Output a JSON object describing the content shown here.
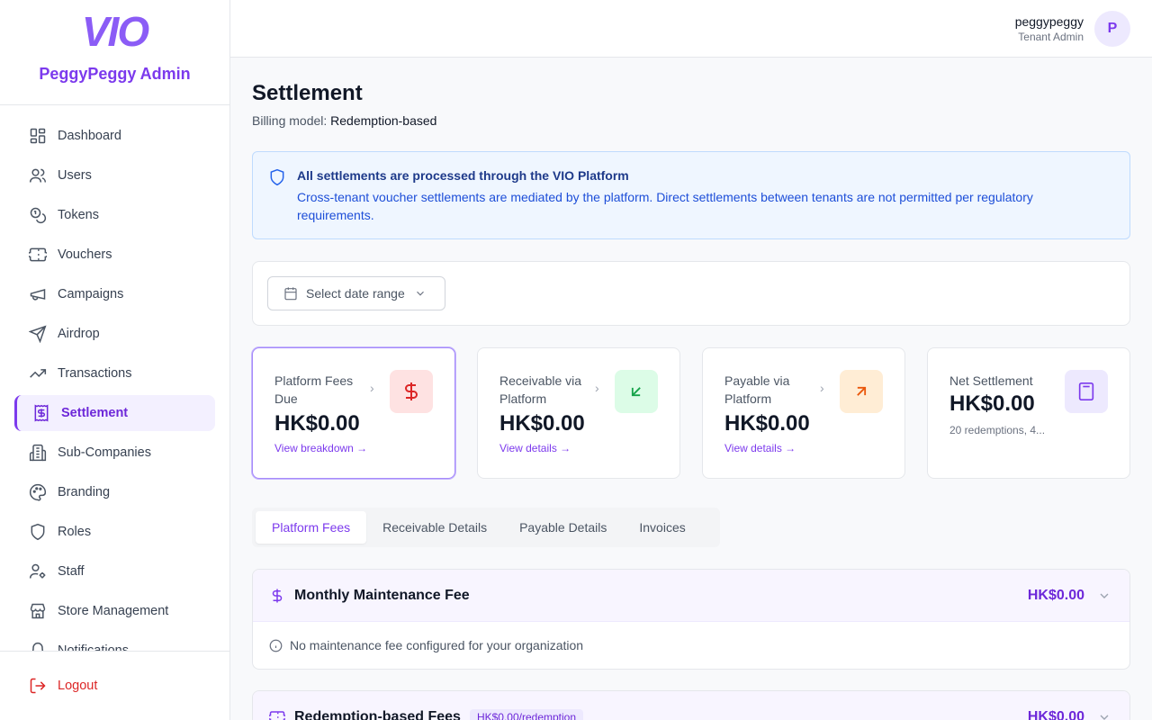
{
  "brand": {
    "logo": "VIO",
    "name": "PeggyPeggy Admin"
  },
  "sidebar": {
    "items": [
      {
        "label": "Dashboard",
        "icon": "dashboard-icon"
      },
      {
        "label": "Users",
        "icon": "users-icon"
      },
      {
        "label": "Tokens",
        "icon": "tokens-icon"
      },
      {
        "label": "Vouchers",
        "icon": "ticket-icon"
      },
      {
        "label": "Campaigns",
        "icon": "megaphone-icon"
      },
      {
        "label": "Airdrop",
        "icon": "send-icon"
      },
      {
        "label": "Transactions",
        "icon": "trending-icon"
      },
      {
        "label": "Settlement",
        "icon": "receipt-dollar-icon",
        "active": true
      },
      {
        "label": "Sub-Companies",
        "icon": "building-icon"
      },
      {
        "label": "Branding",
        "icon": "palette-icon"
      },
      {
        "label": "Roles",
        "icon": "shield-icon"
      },
      {
        "label": "Staff",
        "icon": "user-cog-icon"
      },
      {
        "label": "Store Management",
        "icon": "store-icon"
      },
      {
        "label": "Notifications",
        "icon": "bell-icon"
      }
    ],
    "logout": "Logout"
  },
  "header": {
    "user_name": "peggypeggy",
    "user_role": "Tenant Admin",
    "avatar_initial": "P"
  },
  "page": {
    "title": "Settlement",
    "billing_label": "Billing model:",
    "billing_value": "Redemption-based"
  },
  "alert": {
    "title": "All settlements are processed through the VIO Platform",
    "body": "Cross-tenant voucher settlements are mediated by the platform. Direct settlements between tenants are not permitted per regulatory requirements."
  },
  "filter": {
    "date_placeholder": "Select date range"
  },
  "stats": [
    {
      "label": "Platform Fees Due",
      "value": "HK$0.00",
      "link": "View breakdown →",
      "icon": "dollar-icon",
      "color": "#dc2626",
      "bg": "#fee2e2"
    },
    {
      "label": "Receivable via Platform",
      "value": "HK$0.00",
      "link": "View details →",
      "icon": "arrow-down-left-icon",
      "color": "#16a34a",
      "bg": "#dcfce7"
    },
    {
      "label": "Payable via Platform",
      "value": "HK$0.00",
      "link": "View details →",
      "icon": "arrow-up-right-icon",
      "color": "#ea580c",
      "bg": "#ffedd5"
    },
    {
      "label": "Net Settlement",
      "value": "HK$0.00",
      "sub": "20 redemptions, 4...",
      "icon": "calculator-icon",
      "color": "#7c3aed",
      "bg": "#ede9fe"
    }
  ],
  "tabs": [
    "Platform Fees",
    "Receivable Details",
    "Payable Details",
    "Invoices"
  ],
  "fees": [
    {
      "title": "Monthly Maintenance Fee",
      "amount": "HK$0.00",
      "body": "No maintenance fee configured for your organization"
    },
    {
      "title": "Redemption-based Fees",
      "pill": "HK$0.00/redemption",
      "amount": "HK$0.00"
    }
  ]
}
